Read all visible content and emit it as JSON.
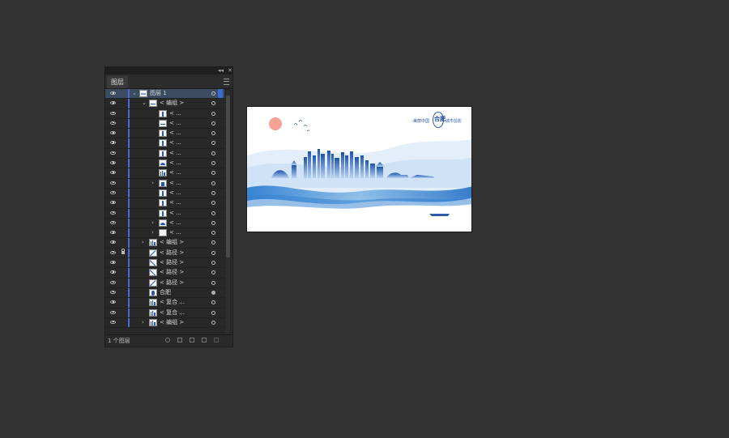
{
  "panel": {
    "collapse_glyph": "◂◂",
    "close_glyph": "✕",
    "tab_label": "图层",
    "footer_count": "1 个图层",
    "layers": [
      {
        "name": "图层 1",
        "indent": 0,
        "chev": "⌄",
        "thumb": "artboard",
        "selected": true
      },
      {
        "name": "< 编组 >",
        "indent": 1,
        "chev": "⌄",
        "thumb": "line"
      },
      {
        "name": "< ...",
        "indent": 2,
        "chev": "",
        "thumb": "tower"
      },
      {
        "name": "< ...",
        "indent": 2,
        "chev": "",
        "thumb": "line"
      },
      {
        "name": "< ...",
        "indent": 2,
        "chev": "",
        "thumb": "tower"
      },
      {
        "name": "< ...",
        "indent": 2,
        "chev": "",
        "thumb": "tower"
      },
      {
        "name": "< ...",
        "indent": 2,
        "chev": "",
        "thumb": "tower"
      },
      {
        "name": "< ...",
        "indent": 2,
        "chev": "",
        "thumb": "dome"
      },
      {
        "name": "< ...",
        "indent": 2,
        "chev": "",
        "thumb": "city"
      },
      {
        "name": "< ...",
        "indent": 2,
        "chev": "›",
        "thumb": "block"
      },
      {
        "name": "< ...",
        "indent": 2,
        "chev": "",
        "thumb": "tower"
      },
      {
        "name": "< ...",
        "indent": 2,
        "chev": "",
        "thumb": "tower"
      },
      {
        "name": "< ...",
        "indent": 2,
        "chev": "",
        "thumb": "tower"
      },
      {
        "name": "< ...",
        "indent": 2,
        "chev": "›",
        "thumb": "dome"
      },
      {
        "name": "< ...",
        "indent": 2,
        "chev": "›",
        "thumb": "blank"
      },
      {
        "name": "< 编组 >",
        "indent": 1,
        "chev": "›",
        "thumb": "city"
      },
      {
        "name": "< 路径 >",
        "indent": 1,
        "chev": "",
        "thumb": "diag",
        "locked": true
      },
      {
        "name": "< 路径 >",
        "indent": 1,
        "chev": "",
        "thumb": "diag2"
      },
      {
        "name": "< 路径 >",
        "indent": 1,
        "chev": "",
        "thumb": "diag2"
      },
      {
        "name": "< 路径 >",
        "indent": 1,
        "chev": "",
        "thumb": "diag"
      },
      {
        "name": "合肥",
        "indent": 1,
        "chev": "",
        "thumb": "seal",
        "target_filled": true
      },
      {
        "name": "< 复合 ...",
        "indent": 1,
        "chev": "",
        "thumb": "city"
      },
      {
        "name": "< 复合 ...",
        "indent": 1,
        "chev": "",
        "thumb": "city"
      },
      {
        "name": "< 编组 >",
        "indent": 1,
        "chev": "›",
        "thumb": "city"
      }
    ]
  },
  "artboard": {
    "text_left": "美丽中国",
    "seal_text": "合肥",
    "text_right": "城市剪影"
  },
  "colors": {
    "canvas": "#323232",
    "layer_color": "#4c6ad6",
    "selected_row": "#3b4c60",
    "brand_blue": "#1c4fa8"
  }
}
